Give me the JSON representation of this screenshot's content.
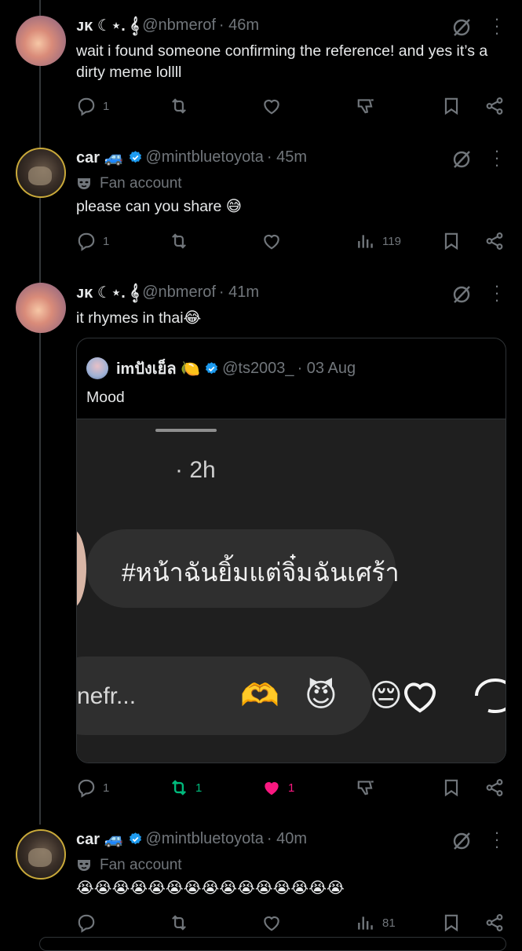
{
  "tweets": [
    {
      "name": "ᴊᴋ ☾⋆. 𝄞",
      "handle": "@nbmerof",
      "time": "· 46m",
      "text": "wait i found someone confirming the reference! and yes it’s a dirty meme lollll",
      "reply_count": "1",
      "retweet_count": "",
      "like_count": "",
      "action_icons": [
        "reply-icon",
        "retweet-icon",
        "like-icon",
        "dislike-icon",
        "bookmark-icon",
        "share-icon"
      ]
    },
    {
      "name": "car 🚙",
      "handle": "@mintbluetoyota",
      "time": "· 45m",
      "badge_label": "Fan account",
      "text": "please can you share 😅",
      "reply_count": "1",
      "views_count": "119",
      "action_icons": [
        "reply-icon",
        "retweet-icon",
        "like-icon",
        "views-icon",
        "bookmark-icon",
        "share-icon"
      ]
    },
    {
      "name": "ᴊᴋ ☾⋆. 𝄞",
      "handle": "@nbmerof",
      "time": "· 41m",
      "text": "it rhymes in thai😂",
      "reply_count": "1",
      "retweet_count": "1",
      "like_count": "1",
      "quote": {
        "name": "imปังเย็ล 🍋",
        "handle": "@ts2003_",
        "time": "· 03 Aug",
        "text": "Mood",
        "media": {
          "time": "· 2h",
          "hashtag": "#หน้าฉันยิ้มแต่จิ๋มฉันเศร้า",
          "reply_preview": "nefr...",
          "reaction_emojis": [
            "🫶",
            "😈",
            "😔"
          ]
        }
      }
    },
    {
      "name": "car 🚙",
      "handle": "@mintbluetoyota",
      "time": "· 40m",
      "badge_label": "Fan account",
      "text": "😭😭😭😭😭😭😭😭😭😭😭😭😭😭😭",
      "reply_count": "",
      "views_count": "81"
    }
  ],
  "colors": {
    "background": "#000000",
    "text": "#e7e9ea",
    "muted": "#71767b",
    "verified": "#1d9bf0",
    "retweet_active": "#00ba7c",
    "like_active": "#f91880"
  }
}
